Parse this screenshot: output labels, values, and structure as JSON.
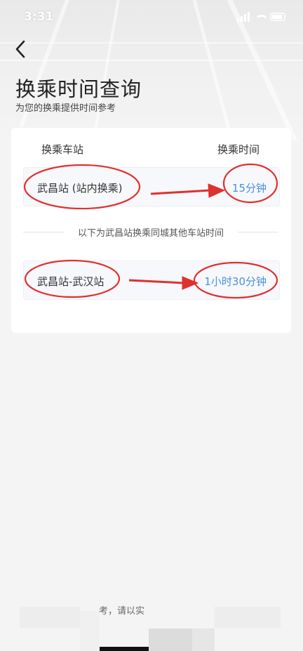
{
  "status_bar": {
    "time": "3:31"
  },
  "header": {
    "back_icon": "chevron-left-icon",
    "title": "换乘时间查询",
    "subtitle": "为您的换乘提供时间参考"
  },
  "card": {
    "column_station": "换乘车站",
    "column_time": "换乘时间",
    "rows": [
      {
        "station": "武昌站 (站内换乘)",
        "time": "15分钟"
      }
    ],
    "divider_text": "以下为武昌站换乘同城其他车站时间",
    "other_rows": [
      {
        "station": "武昌站-武汉站",
        "time": "1小时30分钟"
      }
    ]
  },
  "footer": {
    "note": "考，请以实"
  },
  "colors": {
    "accent": "#4a90d9",
    "annotation": "#e03030"
  }
}
